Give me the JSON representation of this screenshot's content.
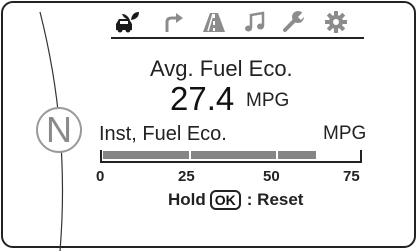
{
  "icon_bar": {
    "icons": [
      "eco-car-icon",
      "turn-arrow-icon",
      "road-icon",
      "music-note-icon",
      "wrench-icon",
      "gear-icon"
    ],
    "active_icon": "eco-car-icon"
  },
  "gear_indicator": "N",
  "average": {
    "title": "Avg. Fuel Eco.",
    "value": "27.4",
    "unit": "MPG"
  },
  "instant": {
    "title": "Inst, Fuel Eco.",
    "unit": "MPG",
    "scale": [
      "0",
      "25",
      "50",
      "75"
    ],
    "scale_max": 75,
    "level": 62
  },
  "reset_hint": {
    "hold": "Hold",
    "button": "OK",
    "action": ": Reset"
  },
  "colors": {
    "bar_fill": "#858585",
    "icon_active": "#1a1a1a",
    "icon_inactive": "#8c8c8c",
    "gear_ring": "#9a9a9a"
  }
}
